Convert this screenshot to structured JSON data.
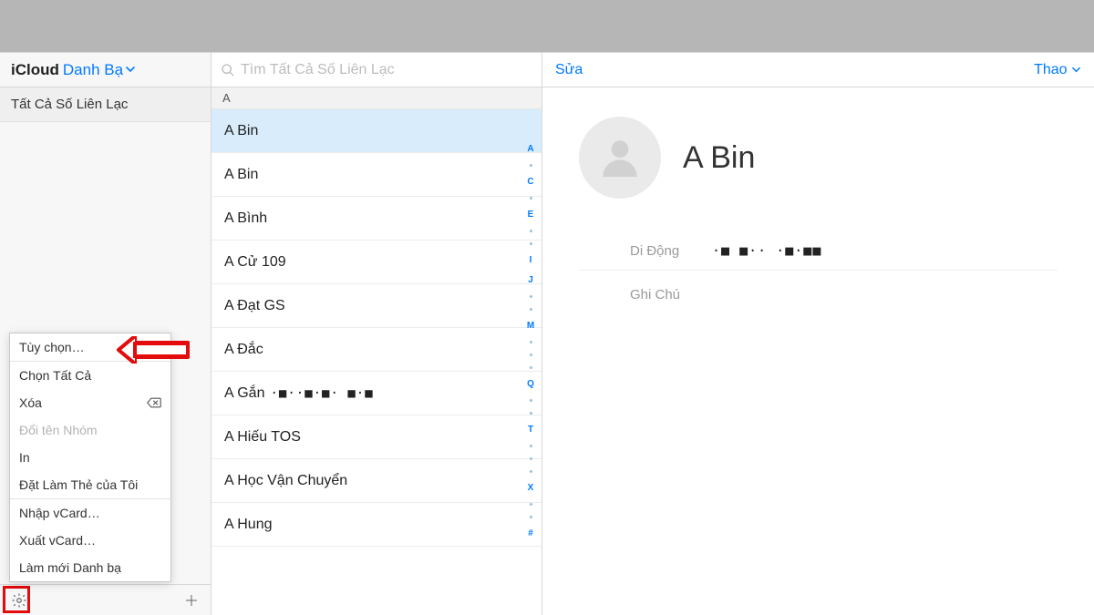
{
  "sidebar": {
    "icloud": "iCloud",
    "title": "Danh Bạ",
    "group": "Tất Cả Số Liên Lạc"
  },
  "popup": {
    "preferences": "Tùy chọn…",
    "select_all": "Chọn Tất Cả",
    "delete": "Xóa",
    "rename_group": "Đổi tên Nhóm",
    "print": "In",
    "set_my_card": "Đặt Làm Thẻ của Tôi",
    "import_vcard": "Nhập vCard…",
    "export_vcard": "Xuất vCard…",
    "refresh": "Làm mới Danh bạ"
  },
  "search": {
    "placeholder": "Tìm Tất Cả Số Liên Lạc"
  },
  "list": {
    "section": "A",
    "contacts": [
      {
        "name": "A Bin",
        "selected": true
      },
      {
        "name": "A Bin"
      },
      {
        "name": "A Bình"
      },
      {
        "name": "A Cử 109"
      },
      {
        "name": "A Đạt GS"
      },
      {
        "name": "A Đắc"
      },
      {
        "name": "A Gắn",
        "masked": "·■··■·■· ■·■"
      },
      {
        "name": "A Hiếu TOS"
      },
      {
        "name": "A Học Vận Chuyển"
      },
      {
        "name": "A Hung"
      }
    ],
    "index": [
      "A",
      "·",
      "C",
      "·",
      "E",
      "·",
      "·",
      "I",
      "J",
      "·",
      "·",
      "M",
      "·",
      "·",
      "·",
      "Q",
      "·",
      "·",
      "T",
      "·",
      "·",
      "·",
      "X",
      "·",
      "·",
      "#"
    ]
  },
  "detail": {
    "edit": "Sửa",
    "action": "Thao",
    "name": "A Bin",
    "mobile_label": "Di Động",
    "mobile_value": "·■   ■·· ·■·■■",
    "note_label": "Ghi Chú"
  }
}
